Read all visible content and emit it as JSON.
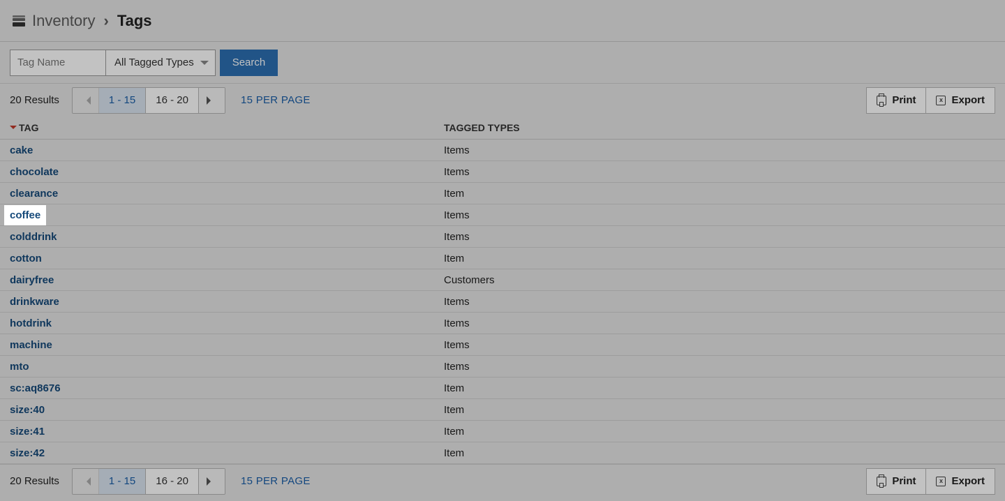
{
  "breadcrumb": {
    "parent": "Inventory",
    "current": "Tags"
  },
  "filter": {
    "tag_placeholder": "Tag Name",
    "type_selected": "All Tagged Types",
    "search_label": "Search"
  },
  "pager": {
    "results_text": "20 Results",
    "pages": [
      "1 - 15",
      "16 - 20"
    ],
    "active_page_index": 0,
    "per_page_label": "15 PER PAGE"
  },
  "toolbar": {
    "print_label": "Print",
    "export_label": "Export"
  },
  "table": {
    "columns": {
      "tag": "TAG",
      "types": "TAGGED TYPES"
    },
    "rows": [
      {
        "tag": "cake",
        "types": "Items",
        "highlight": false
      },
      {
        "tag": "chocolate",
        "types": "Items",
        "highlight": false
      },
      {
        "tag": "clearance",
        "types": "Item",
        "highlight": false
      },
      {
        "tag": "coffee",
        "types": "Items",
        "highlight": true
      },
      {
        "tag": "colddrink",
        "types": "Items",
        "highlight": false
      },
      {
        "tag": "cotton",
        "types": "Item",
        "highlight": false
      },
      {
        "tag": "dairyfree",
        "types": "Customers",
        "highlight": false
      },
      {
        "tag": "drinkware",
        "types": "Items",
        "highlight": false
      },
      {
        "tag": "hotdrink",
        "types": "Items",
        "highlight": false
      },
      {
        "tag": "machine",
        "types": "Items",
        "highlight": false
      },
      {
        "tag": "mto",
        "types": "Items",
        "highlight": false
      },
      {
        "tag": "sc:aq8676",
        "types": "Item",
        "highlight": false
      },
      {
        "tag": "size:40",
        "types": "Item",
        "highlight": false
      },
      {
        "tag": "size:41",
        "types": "Item",
        "highlight": false
      },
      {
        "tag": "size:42",
        "types": "Item",
        "highlight": false
      }
    ]
  }
}
